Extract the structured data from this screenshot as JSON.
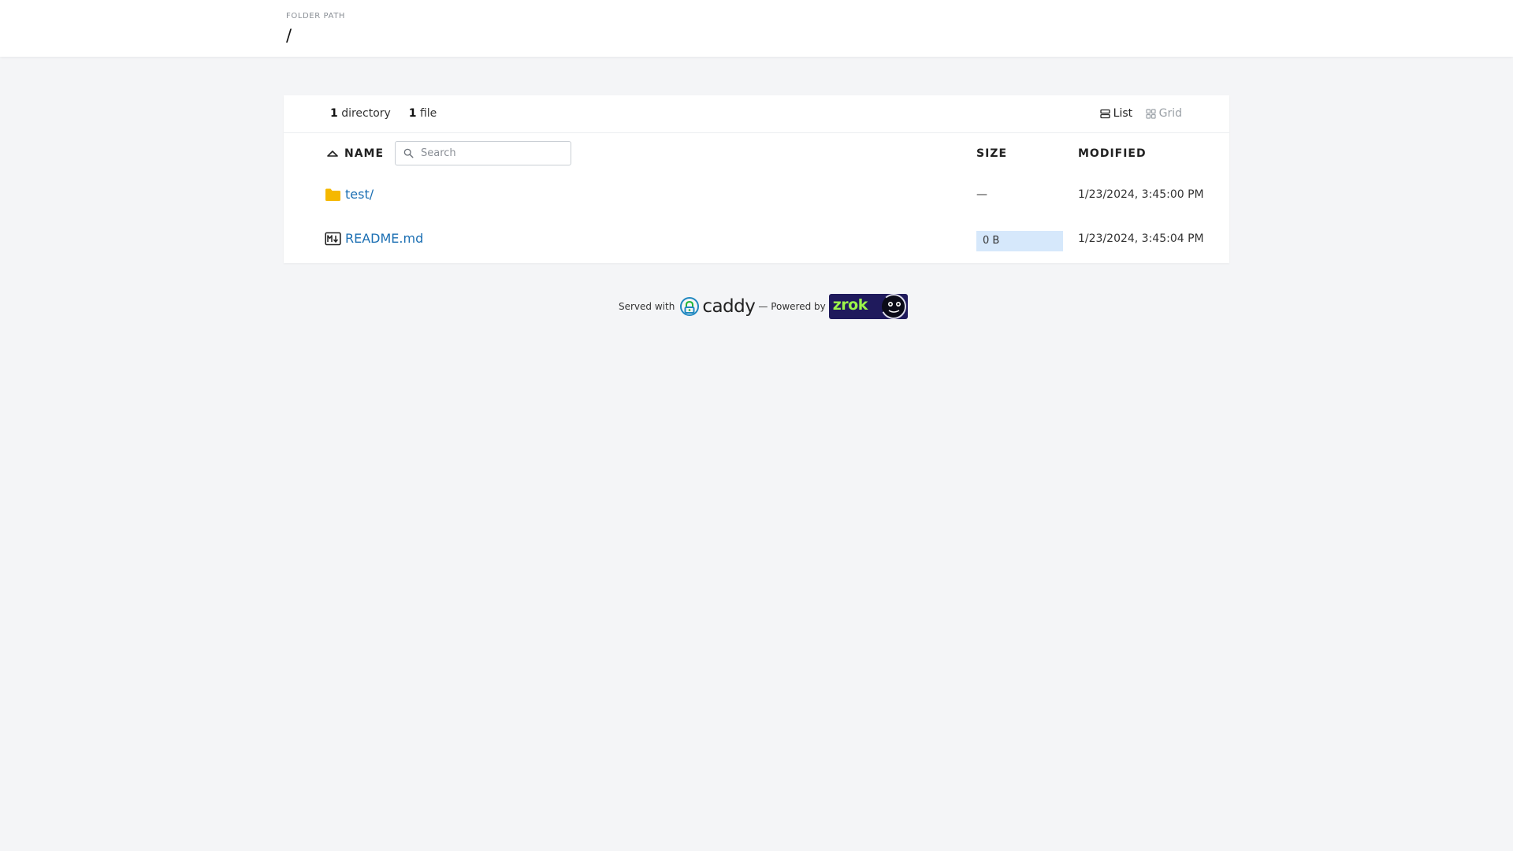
{
  "header": {
    "path_label": "FOLDER PATH",
    "path_value": "/"
  },
  "summary": {
    "dir_count": "1",
    "dir_label": "directory",
    "file_count": "1",
    "file_label": "file"
  },
  "view": {
    "list_label": "List",
    "grid_label": "Grid",
    "active": "List"
  },
  "columns": {
    "name": "NAME",
    "size": "SIZE",
    "modified": "MODIFIED"
  },
  "search": {
    "placeholder": "Search",
    "value": ""
  },
  "rows": [
    {
      "icon": "folder-icon",
      "name": "test/",
      "size": "—",
      "modified": "1/23/2024, 3:45:00 PM"
    },
    {
      "icon": "markdown-file-icon",
      "name": "README.md",
      "size": "0 B",
      "modified": "1/23/2024, 3:45:04 PM"
    }
  ],
  "footer": {
    "served_with": "Served with",
    "caddy": "caddy",
    "powered_by": "— Powered by",
    "zrok": "zrok"
  },
  "colors": {
    "background": "#f4f5f7",
    "link": "#1b6fb3",
    "folder": "#f5b800",
    "size_bar": "#d6e8fb",
    "zrok_bg": "#1f1a5c",
    "zrok_text": "#9cf54a"
  }
}
